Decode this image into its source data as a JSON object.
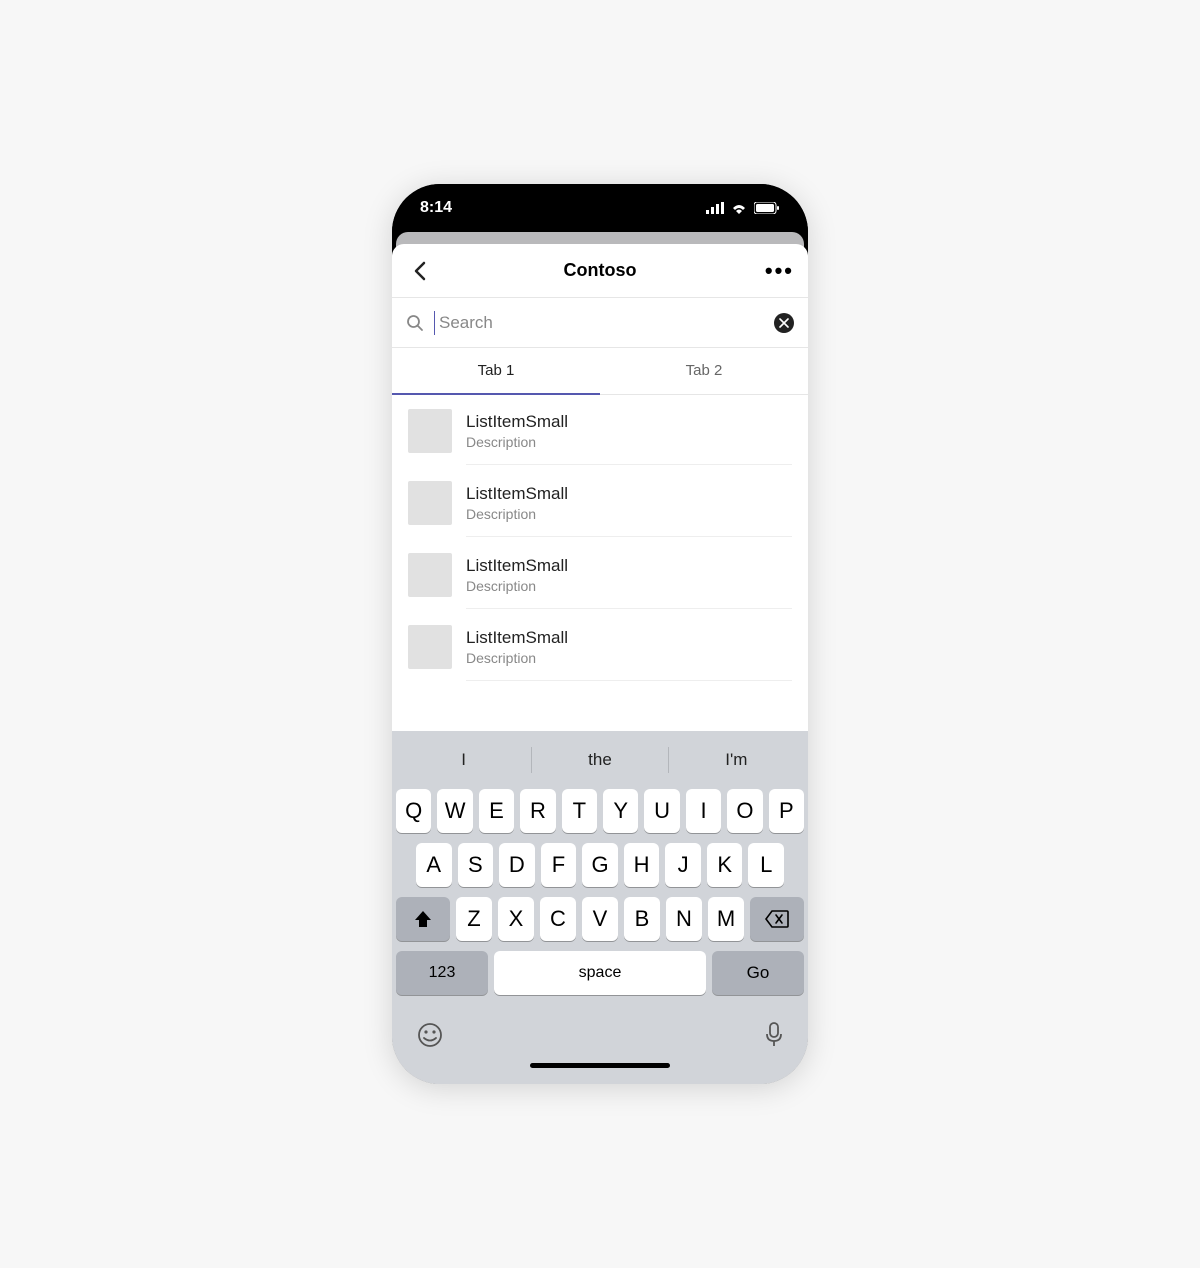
{
  "status": {
    "time": "8:14"
  },
  "header": {
    "title": "Contoso"
  },
  "search": {
    "placeholder": "Search",
    "value": ""
  },
  "tabs": [
    {
      "label": "Tab 1",
      "active": true
    },
    {
      "label": "Tab 2",
      "active": false
    }
  ],
  "list": [
    {
      "title": "ListItemSmall",
      "desc": "Description"
    },
    {
      "title": "ListItemSmall",
      "desc": "Description"
    },
    {
      "title": "ListItemSmall",
      "desc": "Description"
    },
    {
      "title": "ListItemSmall",
      "desc": "Description"
    }
  ],
  "keyboard": {
    "suggestions": [
      "I",
      "the",
      "I'm"
    ],
    "row1": [
      "Q",
      "W",
      "E",
      "R",
      "T",
      "Y",
      "U",
      "I",
      "O",
      "P"
    ],
    "row2": [
      "A",
      "S",
      "D",
      "F",
      "G",
      "H",
      "J",
      "K",
      "L"
    ],
    "row3": [
      "Z",
      "X",
      "C",
      "V",
      "B",
      "N",
      "M"
    ],
    "num": "123",
    "space": "space",
    "go": "Go"
  }
}
